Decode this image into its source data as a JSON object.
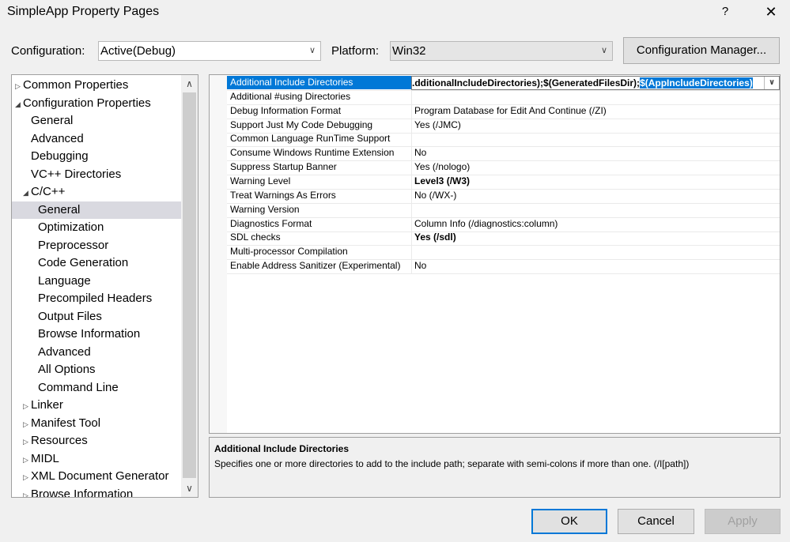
{
  "window": {
    "title": "SimpleApp Property Pages",
    "help_glyph": "?",
    "close_glyph": "✕"
  },
  "config_bar": {
    "configuration_label": "Configuration:",
    "configuration_value": "Active(Debug)",
    "platform_label": "Platform:",
    "platform_value": "Win32",
    "config_manager_label": "Configuration Manager..."
  },
  "tree": [
    {
      "label": "Common Properties",
      "indent": 0,
      "expander": "▷",
      "selected": false
    },
    {
      "label": "Configuration Properties",
      "indent": 0,
      "expander": "◢",
      "selected": false
    },
    {
      "label": "General",
      "indent": 1,
      "expander": "",
      "selected": false
    },
    {
      "label": "Advanced",
      "indent": 1,
      "expander": "",
      "selected": false
    },
    {
      "label": "Debugging",
      "indent": 1,
      "expander": "",
      "selected": false
    },
    {
      "label": "VC++ Directories",
      "indent": 1,
      "expander": "",
      "selected": false
    },
    {
      "label": "C/C++",
      "indent": 1,
      "expander": "◢",
      "selected": false
    },
    {
      "label": "General",
      "indent": 2,
      "expander": "",
      "selected": true
    },
    {
      "label": "Optimization",
      "indent": 2,
      "expander": "",
      "selected": false
    },
    {
      "label": "Preprocessor",
      "indent": 2,
      "expander": "",
      "selected": false
    },
    {
      "label": "Code Generation",
      "indent": 2,
      "expander": "",
      "selected": false
    },
    {
      "label": "Language",
      "indent": 2,
      "expander": "",
      "selected": false
    },
    {
      "label": "Precompiled Headers",
      "indent": 2,
      "expander": "",
      "selected": false
    },
    {
      "label": "Output Files",
      "indent": 2,
      "expander": "",
      "selected": false
    },
    {
      "label": "Browse Information",
      "indent": 2,
      "expander": "",
      "selected": false
    },
    {
      "label": "Advanced",
      "indent": 2,
      "expander": "",
      "selected": false
    },
    {
      "label": "All Options",
      "indent": 2,
      "expander": "",
      "selected": false
    },
    {
      "label": "Command Line",
      "indent": 2,
      "expander": "",
      "selected": false
    },
    {
      "label": "Linker",
      "indent": 1,
      "expander": "▷",
      "selected": false
    },
    {
      "label": "Manifest Tool",
      "indent": 1,
      "expander": "▷",
      "selected": false
    },
    {
      "label": "Resources",
      "indent": 1,
      "expander": "▷",
      "selected": false
    },
    {
      "label": "MIDL",
      "indent": 1,
      "expander": "▷",
      "selected": false
    },
    {
      "label": "XML Document Generator",
      "indent": 1,
      "expander": "▷",
      "selected": false
    },
    {
      "label": "Browse Information",
      "indent": 1,
      "expander": "▷",
      "selected": false
    }
  ],
  "properties": [
    {
      "name": "Additional Include Directories",
      "value": "",
      "bold": false,
      "selected": true
    },
    {
      "name": "Additional #using Directories",
      "value": "",
      "bold": false,
      "selected": false
    },
    {
      "name": "Debug Information Format",
      "value": "Program Database for Edit And Continue (/ZI)",
      "bold": false,
      "selected": false
    },
    {
      "name": "Support Just My Code Debugging",
      "value": "Yes (/JMC)",
      "bold": false,
      "selected": false
    },
    {
      "name": "Common Language RunTime Support",
      "value": "",
      "bold": false,
      "selected": false
    },
    {
      "name": "Consume Windows Runtime Extension",
      "value": "No",
      "bold": false,
      "selected": false
    },
    {
      "name": "Suppress Startup Banner",
      "value": "Yes (/nologo)",
      "bold": false,
      "selected": false
    },
    {
      "name": "Warning Level",
      "value": "Level3 (/W3)",
      "bold": true,
      "selected": false
    },
    {
      "name": "Treat Warnings As Errors",
      "value": "No (/WX-)",
      "bold": false,
      "selected": false
    },
    {
      "name": "Warning Version",
      "value": "",
      "bold": false,
      "selected": false
    },
    {
      "name": "Diagnostics Format",
      "value": "Column Info (/diagnostics:column)",
      "bold": false,
      "selected": false
    },
    {
      "name": "SDL checks",
      "value": "Yes (/sdl)",
      "bold": true,
      "selected": false
    },
    {
      "name": "Multi-processor Compilation",
      "value": "",
      "bold": false,
      "selected": false
    },
    {
      "name": "Enable Address Sanitizer (Experimental)",
      "value": "No",
      "bold": false,
      "selected": false
    }
  ],
  "edit_box": {
    "text_before": ".dditionalIncludeDirectories);$(GeneratedFilesDir);",
    "text_highlighted": "$(AppIncludeDirectories)"
  },
  "description": {
    "title": "Additional Include Directories",
    "text": "Specifies one or more directories to add to the include path; separate with semi-colons if more than one.    (/I[path])"
  },
  "buttons": {
    "ok": "OK",
    "cancel": "Cancel",
    "apply": "Apply"
  },
  "colors": {
    "selection": "#0078d7",
    "tree_selection": "#d9d9e0",
    "dialog_bg": "#f0f0f0"
  }
}
